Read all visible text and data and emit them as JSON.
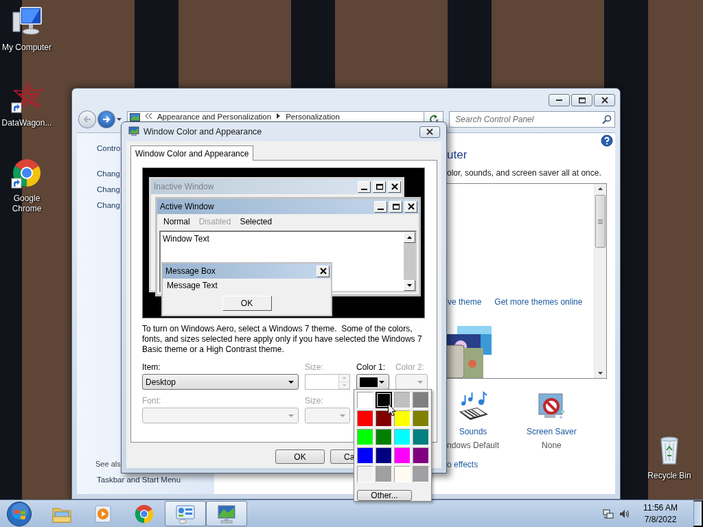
{
  "desktop_icons": [
    {
      "kind": "computer",
      "label": "My Computer"
    },
    {
      "kind": "datawagon",
      "label": "DataWagon..."
    },
    {
      "kind": "chrome",
      "label": "Google Chrome"
    },
    {
      "kind": "recycle",
      "label": "Recycle Bin"
    }
  ],
  "control_panel": {
    "breadcrumb": [
      "Appearance and Personalization",
      "Personalization"
    ],
    "search": {
      "placeholder": "Search Control Panel"
    },
    "sidebar": {
      "items": [
        "Contro",
        "Chang",
        "Chang",
        "Chang"
      ],
      "see_also": "See als",
      "see_also_links": [
        "Taskbar and Start Menu"
      ]
    },
    "heading": "uter",
    "description": "olor, sounds, and screen saver all at once.",
    "theme_links": [
      "ve theme",
      "Get more themes online"
    ],
    "settings": [
      {
        "kind": "sounds",
        "label": "Sounds",
        "value": "ndows Default"
      },
      {
        "kind": "screen_saver",
        "label": "Screen Saver",
        "value": "None"
      }
    ],
    "effects_link": "o effects"
  },
  "dialog": {
    "title": "Window Color and Appearance",
    "tabs": [
      {
        "label": "Window Color and Appearance",
        "selected": true
      }
    ],
    "preview": {
      "inactive_title": "Inactive Window",
      "active_title": "Active Window",
      "menu": [
        {
          "label": "Normal",
          "disabled": false
        },
        {
          "label": "Disabled",
          "disabled": true
        },
        {
          "label": "Selected",
          "disabled": false
        }
      ],
      "window_text": "Window Text",
      "message_box": {
        "title": "Message Box",
        "text": "Message Text",
        "button": "OK"
      }
    },
    "note": "To turn on Windows Aero, select a Windows 7 theme.  Some of the colors, fonts, and sizes selected here apply only if you have selected the Windows 7 Basic theme or a High Contrast theme.",
    "fields": [
      {
        "kind": "dropdown",
        "label": "Item:",
        "value": "Desktop",
        "disabled": false
      },
      {
        "kind": "spinner",
        "label": "Size:",
        "disabled": true
      },
      {
        "kind": "color",
        "label": "Color 1:",
        "color": "#000000",
        "disabled": false
      },
      {
        "kind": "color",
        "label": "Color 2:",
        "disabled": true
      },
      {
        "kind": "dropdown",
        "label": "Font:",
        "disabled": true
      },
      {
        "kind": "dropdown",
        "label": "Size:",
        "disabled": true
      }
    ],
    "buttons": [
      "OK",
      "Ca"
    ]
  },
  "color_menu": {
    "swatches": [
      {
        "color": "#ffffff",
        "selected": false
      },
      {
        "color": "#000000",
        "selected": true
      },
      {
        "color": "#c0c0c0",
        "selected": false
      },
      {
        "color": "#808080",
        "selected": false
      },
      {
        "color": "#ff0000",
        "selected": false
      },
      {
        "color": "#800000",
        "selected": false
      },
      {
        "color": "#ffff00",
        "selected": false
      },
      {
        "color": "#808000",
        "selected": false
      },
      {
        "color": "#00ff00",
        "selected": false
      },
      {
        "color": "#008000",
        "selected": false
      },
      {
        "color": "#00ffff",
        "selected": false
      },
      {
        "color": "#008080",
        "selected": false
      },
      {
        "color": "#0000ff",
        "selected": false
      },
      {
        "color": "#000080",
        "selected": false
      },
      {
        "color": "#ff00ff",
        "selected": false
      },
      {
        "color": "#800080",
        "selected": false
      },
      {
        "color": "#f0f0f0",
        "selected": false
      },
      {
        "color": "#a0a0a0",
        "selected": false
      },
      {
        "color": "#fffbf0",
        "selected": false
      },
      {
        "color": "#a0a0a4",
        "selected": false
      }
    ],
    "other_button": "Other..."
  },
  "taskbar": {
    "apps": [
      {
        "kind": "explorer",
        "active": false
      },
      {
        "kind": "media_player",
        "active": false
      },
      {
        "kind": "chrome",
        "active": false
      },
      {
        "kind": "control_panel",
        "active": true
      },
      {
        "kind": "display",
        "active": true
      }
    ],
    "time": "11:56 AM",
    "date": "7/8/2022"
  }
}
